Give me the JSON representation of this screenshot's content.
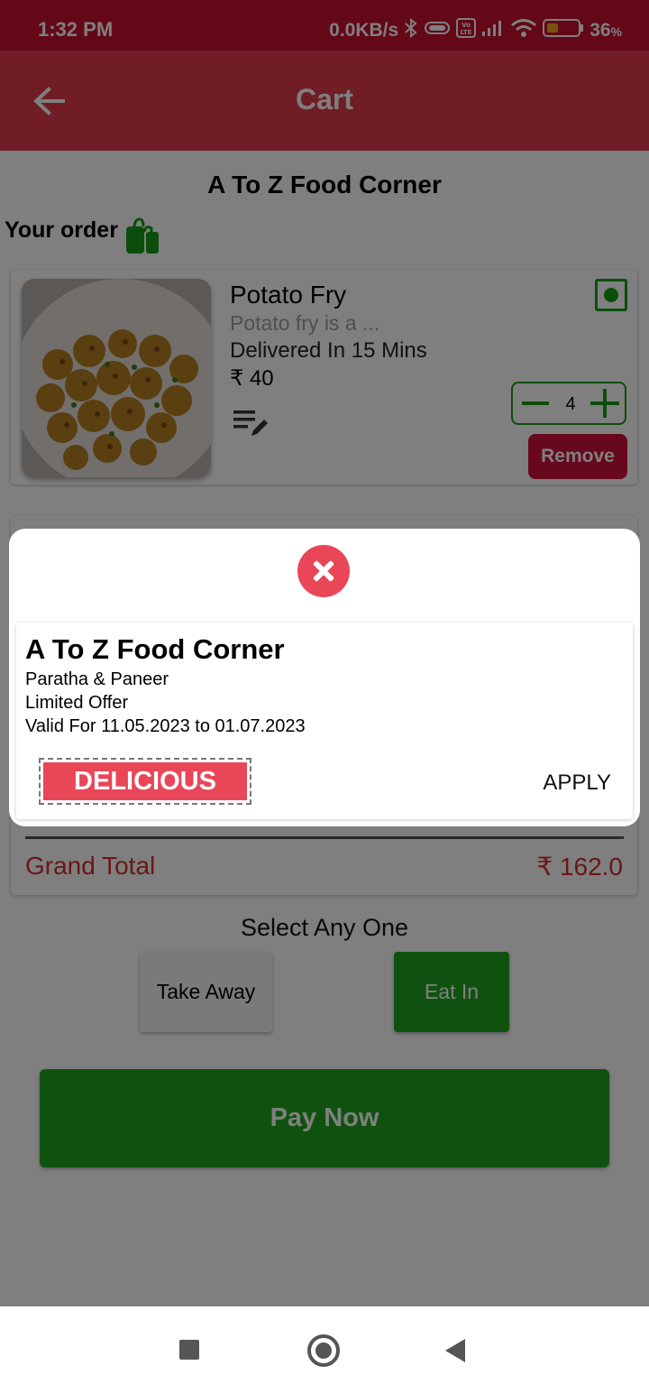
{
  "status_bar": {
    "time": "1:32 PM",
    "network_speed": "0.0KB/s",
    "battery": "36",
    "battery_unit": "%"
  },
  "app_bar": {
    "title": "Cart",
    "back_icon": "arrow-back-icon"
  },
  "cart": {
    "restaurant_name": "A To Z Food Corner",
    "your_order_label": "Your order",
    "item": {
      "name": "Potato Fry",
      "description": "Potato fry is a ...",
      "delivery": "Delivered In 15 Mins",
      "price": "₹ 40",
      "quantity": "4",
      "remove_label": "Remove"
    },
    "grand_total_label": "Grand Total",
    "grand_total_value": "₹ 162.0",
    "select_label": "Select Any One",
    "take_away_label": "Take Away",
    "eat_in_label": "Eat In",
    "pay_now_label": "Pay Now"
  },
  "coupon_dialog": {
    "title": "A To Z Food Corner",
    "subtitle": "Paratha & Paneer",
    "offer": "Limited Offer",
    "validity": "Valid For 11.05.2023 to 01.07.2023",
    "code": "DELICIOUS",
    "apply_label": "APPLY"
  },
  "colors": {
    "brand_red": "#e23a4a",
    "status_red": "#c8102e",
    "veg_green": "#169c16",
    "action_green": "#1ea51e",
    "coupon_red": "#e94657"
  }
}
